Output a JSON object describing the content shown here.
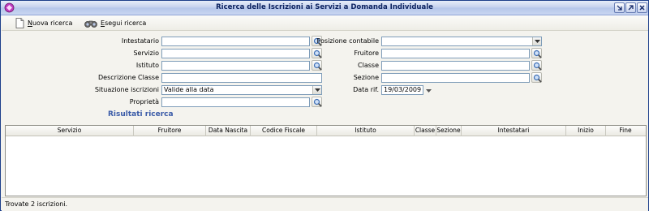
{
  "window": {
    "title": "Ricerca delle Iscrizioni ai Servizi a Domanda Individuale"
  },
  "toolbar": {
    "new_search_label": "Nuova ricerca",
    "run_search_label": "Esegui ricerca"
  },
  "form": {
    "intestatario_label": "Intestatario",
    "intestatario_value": "",
    "servizio_label": "Servizio",
    "servizio_value": "",
    "istituto_label": "Istituto",
    "istituto_value": "",
    "descrizione_classe_label": "Descrizione Classe",
    "descrizione_classe_value": "",
    "situazione_iscrizioni_label": "Situazione iscrizioni",
    "situazione_iscrizioni_value": "Valide alla data",
    "proprieta_label": "Proprietà",
    "proprieta_value": "",
    "posizione_contabile_label": "Posizione contabile",
    "posizione_contabile_value": "",
    "fruitore_label": "Fruitore",
    "fruitore_value": "",
    "classe_label": "Classe",
    "classe_value": "",
    "sezione_label": "Sezione",
    "sezione_value": "",
    "data_rif_label": "Data rif.",
    "data_rif_value": "19/03/2009"
  },
  "results": {
    "title": "Risultati ricerca",
    "columns": [
      "Servizio",
      "Fruitore",
      "Data Nascita",
      "Codice Fiscale",
      "Istituto",
      "Classe",
      "Sezione",
      "Intestatari",
      "Inizio",
      "Fine"
    ],
    "rows": []
  },
  "status": {
    "text": "Trovate 2 iscrizioni."
  },
  "colors": {
    "accent": "#3a5ba8",
    "title_text": "#0b2260",
    "window_border": "#1d3f8a"
  }
}
